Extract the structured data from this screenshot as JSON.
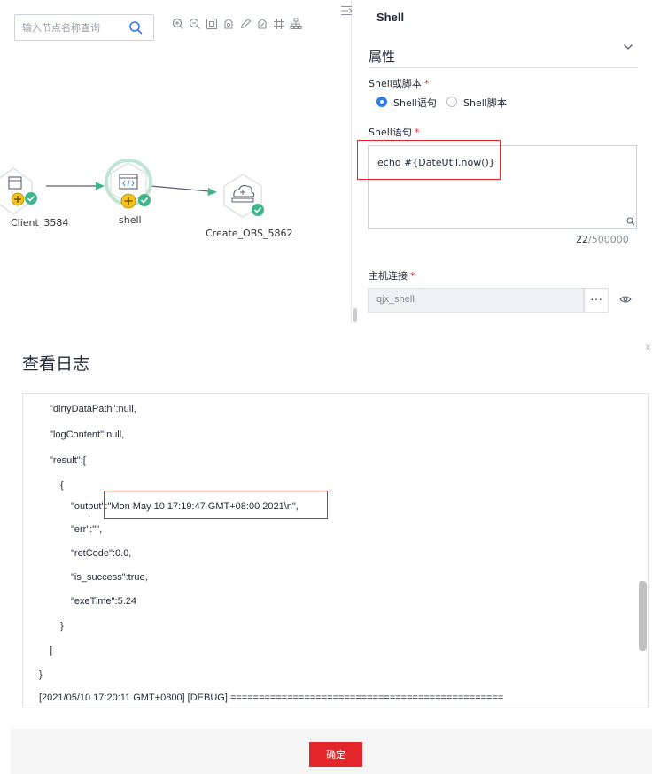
{
  "canvas": {
    "search_placeholder": "输入节点名称查询",
    "toolbar_icons": [
      "zoom-in-icon",
      "zoom-out-icon",
      "fit-screen-icon",
      "lock-icon",
      "edit-icon",
      "delete-icon",
      "grid-icon",
      "layout-icon"
    ],
    "nodes": {
      "client": "Client_3584",
      "shell": "shell",
      "obs": "Create_OBS_5862"
    }
  },
  "panel": {
    "title": "Shell",
    "section_title": "属性",
    "shell_or_script_label": "Shell或脚本",
    "required_mark": "*",
    "radio_statement": "Shell语句",
    "radio_script": "Shell脚本",
    "radio_selected": "Shell语句",
    "shell_statement_label": "Shell语句",
    "shell_statement_value": "echo #{DateUtil.now()}",
    "char_count": "22",
    "char_max": "/500000",
    "host_label": "主机连接",
    "host_value": "qjx_shell",
    "host_more": "···"
  },
  "dialog": {
    "title": "查看日志",
    "close": "x",
    "log_lines": [
      "\"dirtyDataPath\":null,",
      "\"logContent\":null,",
      "\"result\":[",
      "{",
      "\"output\":\"Mon May 10 17:19:47 GMT+08:00 2021\\n\",",
      "\"err\":\"\",",
      "\"retCode\":0.0,",
      "\"is_success\":true,",
      "\"exeTime\":5.24",
      "}",
      "]",
      "}",
      "[2021/05/10 17:20:11 GMT+0800] [DEBUG] ================================================"
    ],
    "ok_label": "确定"
  },
  "colors": {
    "accent_red": "#e3262b",
    "accent_blue": "#2e7be8",
    "success_green": "#3fb58a",
    "node_yellow": "#f5c21b"
  }
}
